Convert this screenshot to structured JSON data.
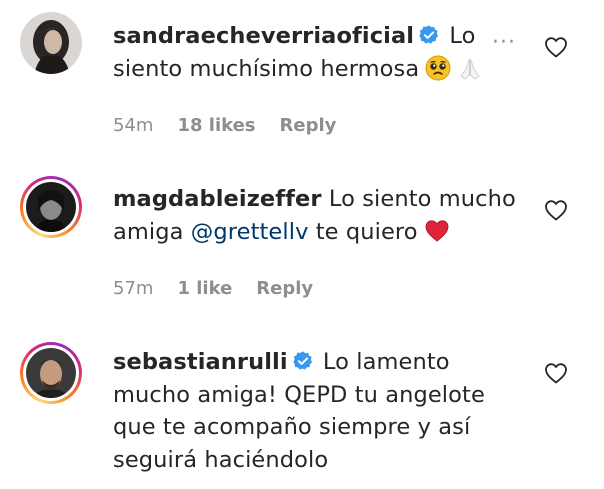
{
  "comments": [
    {
      "username": "sandraecheverriaoficial",
      "verified": true,
      "text_lines": [
        "Lo",
        "siento muchísimo hermosa"
      ],
      "emojis": [
        "pleading-face-emoji",
        "folded-hands-emoji"
      ],
      "time": "54m",
      "likes": "18 likes",
      "reply": "Reply",
      "more": "···"
    },
    {
      "username": "magdableizeffer",
      "verified": false,
      "text_before": "Lo siento mucho",
      "text_line2_prefix": "amiga",
      "mention": "@grettellv",
      "text_after": "te quiero",
      "emojis": [
        "red-heart-emoji"
      ],
      "time": "57m",
      "likes": "1 like",
      "reply": "Reply"
    },
    {
      "username": "sebastianrulli",
      "verified": true,
      "text_lines": [
        "Lo lamento",
        "mucho amiga! QEPD tu angelote",
        "que te acompaño siempre y así",
        "seguirá haciéndolo"
      ]
    }
  ]
}
